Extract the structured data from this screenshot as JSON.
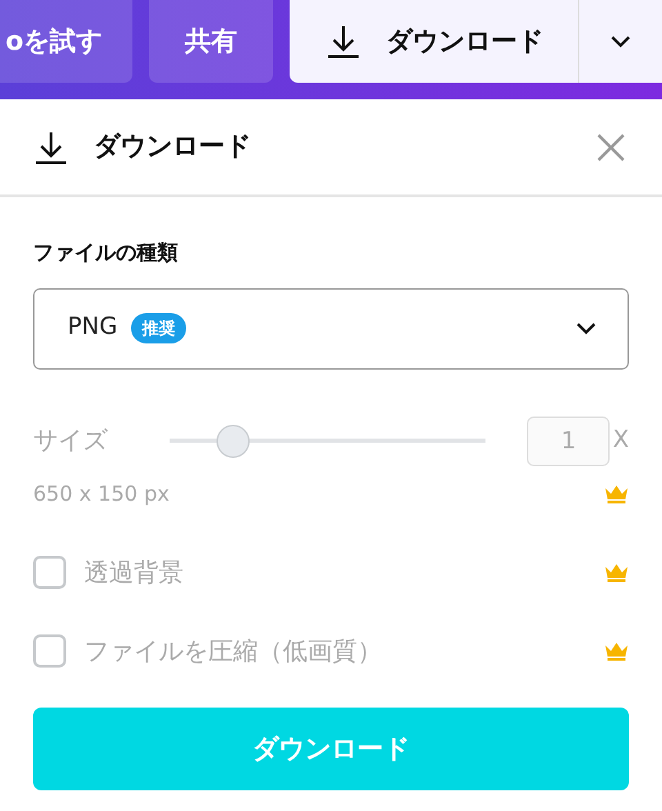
{
  "top_bar": {
    "buttons": [
      {
        "label": "oを試す",
        "kind": "plain"
      },
      {
        "label": "共有",
        "kind": "plain"
      },
      {
        "label": "ダウンロード",
        "kind": "download"
      }
    ]
  },
  "panel": {
    "title": "ダウンロード",
    "file_type": {
      "label": "ファイルの種類",
      "value": "PNG",
      "badge": "推奨"
    },
    "size": {
      "label": "サイズ",
      "level": 0.2,
      "value": "1",
      "unit": "X",
      "disabled": true,
      "dimensions": "650 x 150 px",
      "premium": true
    },
    "options": [
      {
        "label": "透過背景",
        "checked": false,
        "disabled": true,
        "premium": true
      },
      {
        "label": "ファイルを圧縮（低画質）",
        "checked": false,
        "disabled": true,
        "premium": true
      }
    ],
    "button": "ダウンロード"
  }
}
